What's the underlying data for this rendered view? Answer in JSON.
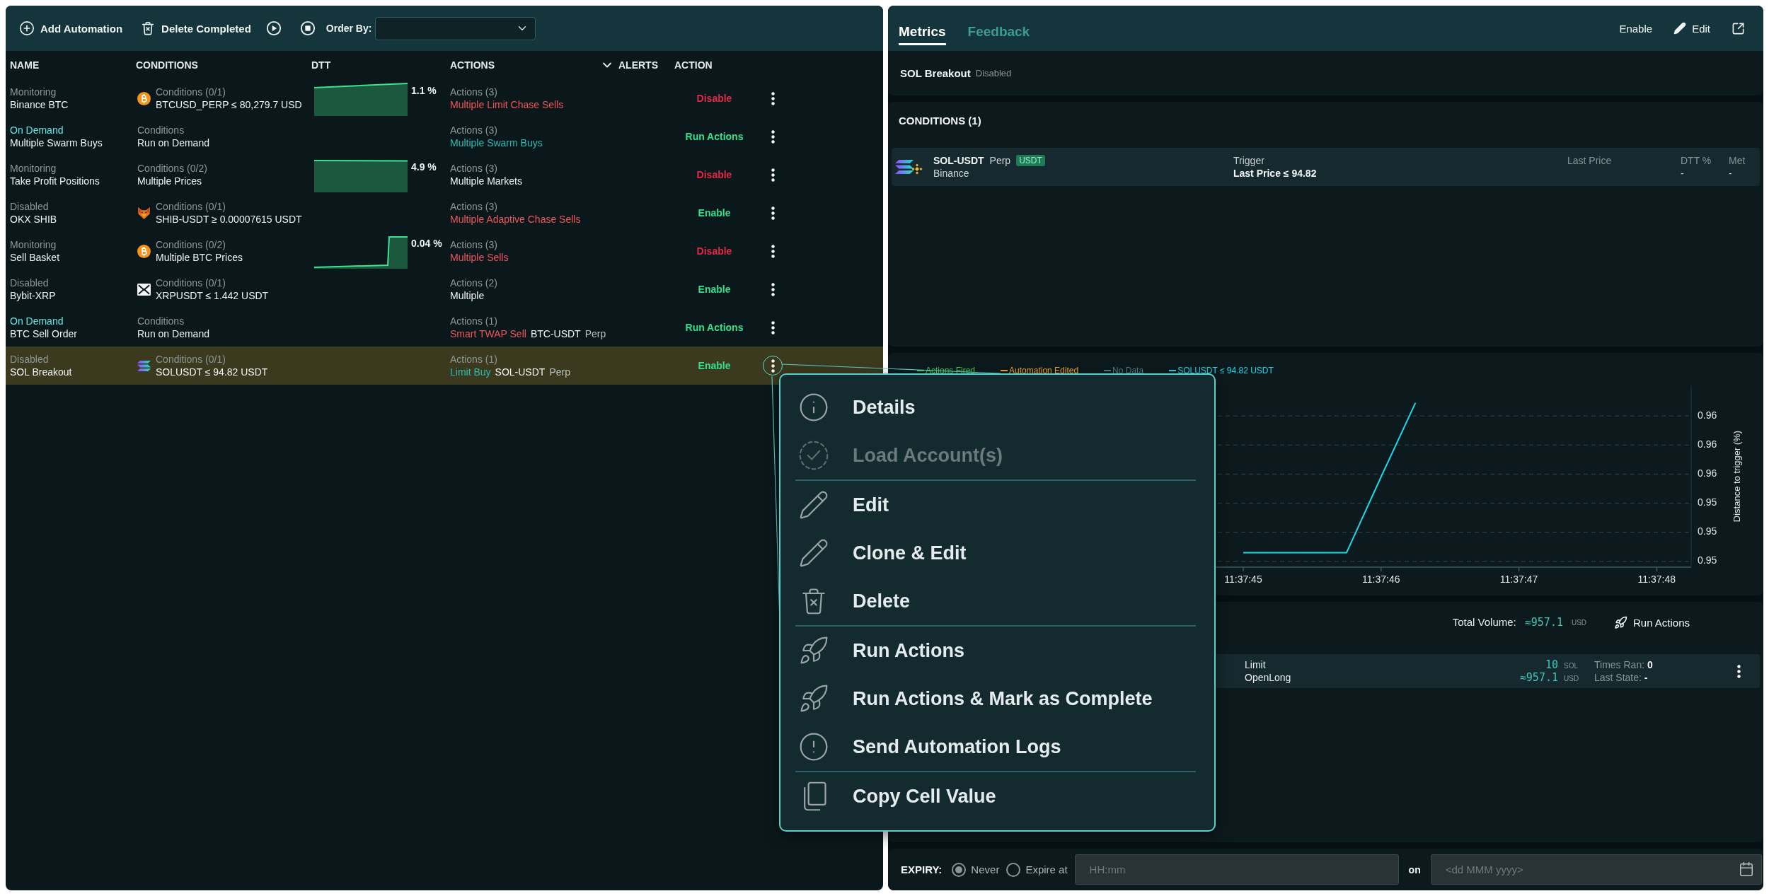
{
  "toolbar": {
    "buttons": [
      {
        "label": "Add Automation",
        "kind": "add"
      },
      {
        "label": "Delete Completed",
        "kind": "delete_completed"
      }
    ],
    "order_by": {
      "label": "Order By:"
    }
  },
  "table": {
    "columns": [
      {
        "label": "NAME",
        "caret": false
      },
      {
        "label": "CONDITIONS",
        "caret": false
      },
      {
        "label": "DTT",
        "caret": false
      },
      {
        "label": "ACTIONS",
        "caret": false
      },
      {
        "label": "ALERTS",
        "caret": true
      },
      {
        "label": "ACTION",
        "caret": false
      }
    ],
    "rows": [
      {
        "status": {
          "label": "Monitoring",
          "kind": "monitoring"
        },
        "name": "Binance BTC",
        "conditions": {
          "kind": "btc",
          "title": "Conditions (0/1)",
          "detail": "BTCUSD_PERP ≤ 80,279.7 USD"
        },
        "dtt": {
          "kind": "rising",
          "reading": "1.1 %"
        },
        "actions": {
          "title": "Actions (3)",
          "parts": [
            {
              "text": "Multiple Limit Chase Sells",
              "kind": "sell"
            }
          ]
        },
        "action": {
          "label": "Disable",
          "kind": "disable"
        },
        "selected": false,
        "menu_open": false
      },
      {
        "status": {
          "label": "On Demand",
          "kind": "on_demand"
        },
        "name": "Multiple Swarm Buys",
        "conditions": {
          "title": "Conditions",
          "detail": "Run on Demand"
        },
        "actions": {
          "title": "Actions (3)",
          "parts": [
            {
              "text": "Multiple Swarm Buys",
              "kind": "buy"
            }
          ]
        },
        "action": {
          "label": "Run Actions",
          "kind": "run"
        },
        "selected": false,
        "menu_open": false
      },
      {
        "status": {
          "label": "Monitoring",
          "kind": "monitoring"
        },
        "name": "Take Profit Positions",
        "conditions": {
          "title": "Conditions (0/2)",
          "detail": "Multiple Prices"
        },
        "dtt": {
          "kind": "flat",
          "reading": "4.9 %"
        },
        "actions": {
          "title": "Actions (3)",
          "parts": [
            {
              "text": "Multiple Markets",
              "kind": "plain"
            }
          ]
        },
        "action": {
          "label": "Disable",
          "kind": "disable"
        },
        "selected": false,
        "menu_open": false
      },
      {
        "status": {
          "label": "Disabled",
          "kind": "disabled"
        },
        "name": "OKX SHIB",
        "conditions": {
          "kind": "shib",
          "title": "Conditions (0/1)",
          "detail": "SHIB-USDT ≥ 0.00007615 USDT"
        },
        "actions": {
          "title": "Actions (3)",
          "parts": [
            {
              "text": "Multiple Adaptive Chase Sells",
              "kind": "sell"
            }
          ]
        },
        "action": {
          "label": "Enable",
          "kind": "enable"
        },
        "selected": false,
        "menu_open": false
      },
      {
        "status": {
          "label": "Monitoring",
          "kind": "monitoring"
        },
        "name": "Sell Basket",
        "conditions": {
          "kind": "btc",
          "title": "Conditions (0/2)",
          "detail": "Multiple BTC Prices"
        },
        "dtt": {
          "kind": "step",
          "reading": "0.04 %"
        },
        "actions": {
          "title": "Actions (3)",
          "parts": [
            {
              "text": "Multiple Sells",
              "kind": "sell"
            }
          ]
        },
        "action": {
          "label": "Disable",
          "kind": "disable"
        },
        "selected": false,
        "menu_open": false
      },
      {
        "status": {
          "label": "Disabled",
          "kind": "disabled"
        },
        "name": "Bybit-XRP",
        "conditions": {
          "kind": "xrp",
          "title": "Conditions (0/1)",
          "detail": "XRPUSDT ≤ 1.442 USDT"
        },
        "actions": {
          "title": "Actions (2)",
          "parts": [
            {
              "text": "Multiple",
              "kind": "plain"
            }
          ]
        },
        "action": {
          "label": "Enable",
          "kind": "enable"
        },
        "selected": false,
        "menu_open": false
      },
      {
        "status": {
          "label": "On Demand",
          "kind": "on_demand"
        },
        "name": "BTC Sell Order",
        "conditions": {
          "title": "Conditions",
          "detail": "Run on Demand"
        },
        "actions": {
          "title": "Actions (1)",
          "parts": [
            {
              "text": "Smart TWAP Sell",
              "kind": "sell"
            },
            {
              "text": "BTC-USDT",
              "kind": "plain"
            },
            {
              "text": "Perp",
              "kind": "muted"
            }
          ]
        },
        "action": {
          "label": "Run Actions",
          "kind": "run"
        },
        "selected": false,
        "menu_open": false
      },
      {
        "status": {
          "label": "Disabled",
          "kind": "disabled"
        },
        "name": "SOL Breakout",
        "conditions": {
          "kind": "sol",
          "title": "Conditions (0/1)",
          "detail": "SOLUSDT ≤ 94.82 USDT"
        },
        "actions": {
          "title": "Actions (1)",
          "parts": [
            {
              "text": "Limit Buy",
              "kind": "buy"
            },
            {
              "text": "SOL-USDT",
              "kind": "plain"
            },
            {
              "text": "Perp",
              "kind": "muted"
            }
          ]
        },
        "action": {
          "label": "Enable",
          "kind": "enable"
        },
        "selected": true,
        "menu_open": true
      }
    ]
  },
  "detail": {
    "tabs": [
      {
        "label": "Metrics",
        "selected": true
      },
      {
        "label": "Feedback",
        "selected": false
      }
    ],
    "header_actions": {
      "enable": "Enable",
      "edit": "Edit"
    },
    "title": "SOL Breakout",
    "status": "Disabled",
    "conditions": {
      "title": "CONDITIONS (1)",
      "items": [
        {
          "symbol": "SOL-USDT",
          "contract": "Perp",
          "quote_badge": "USDT",
          "exchange": "Binance",
          "trigger_label": "Trigger",
          "trigger": "Last Price ≤ 94.82",
          "last_price_label": "Last Price",
          "dtt_label": "DTT %",
          "dtt": "-",
          "met_label": "Met",
          "met": "-"
        }
      ]
    },
    "chart": {
      "chart_data": {
        "type": "line",
        "ylabel": "Distance to trigger (%)",
        "grid": true,
        "categories": [
          null,
          null,
          null,
          null,
          null,
          null,
          null,
          null,
          null,
          null,
          "11:37:45",
          null,
          null,
          null,
          "11:37:46",
          null,
          null,
          null,
          "11:37:47",
          null,
          null,
          null,
          "11:37:48",
          null
        ],
        "series": [
          {
            "name": "Actions Fired",
            "color": "#39d353",
            "values": [
              null,
              null,
              null,
              null,
              null,
              null,
              null,
              null,
              null,
              null,
              null,
              null,
              null,
              null,
              null,
              null,
              null,
              null,
              null,
              null,
              null,
              null,
              null,
              null
            ]
          },
          {
            "name": "Automation Edited",
            "color": "#f5a623",
            "values": [
              null,
              null,
              null,
              null,
              null,
              null,
              null,
              null,
              null,
              null,
              null,
              null,
              null,
              null,
              null,
              null,
              null,
              null,
              null,
              null,
              null,
              null,
              null,
              null
            ]
          },
          {
            "name": "No Data",
            "color": "#4f7f86",
            "values": [
              null,
              null,
              null,
              null,
              null,
              null,
              null,
              null,
              null,
              null,
              null,
              null,
              null,
              null,
              null,
              null,
              null,
              null,
              null,
              null,
              null,
              null,
              null,
              null
            ]
          },
          {
            "name": "SOLUSDT ≤ 94.82 USDT",
            "color": "#1ed8ea",
            "values": [
              null,
              null,
              null,
              null,
              null,
              null,
              null,
              null,
              null,
              null,
              0.9506,
              0.9506,
              0.9506,
              0.9506,
              0.9558,
              0.9609,
              null,
              null,
              null,
              null,
              null,
              null,
              null,
              null
            ]
          }
        ],
        "ylim": [
          0.9496,
          0.9621
        ],
        "yticks": [
          {
            "value": 0.96,
            "label": "0.96"
          },
          {
            "value": 0.958,
            "label": "0.96"
          },
          {
            "value": 0.956,
            "label": "0.96"
          },
          {
            "value": 0.954,
            "label": "0.95"
          },
          {
            "value": 0.952,
            "label": "0.95"
          },
          {
            "value": 0.95,
            "label": "0.95"
          }
        ]
      }
    },
    "actions": {
      "total_label": "Total Volume:",
      "total": "≈957.1",
      "total_unit": "USD",
      "run": "Run Actions",
      "items": [
        {
          "order_type": "Limit",
          "side": "OpenLong",
          "quantity": "10",
          "quantity_unit": "SOL",
          "value": "≈957.1",
          "value_unit": "USD",
          "times_ran": "Times Ran: **0**",
          "last_state": "Last State: **-**"
        }
      ]
    },
    "expiry": {
      "label": "EXPIRY:",
      "options": [
        {
          "label": "Never",
          "selected": true
        },
        {
          "label": "Expire at",
          "selected": false
        }
      ],
      "time_field": {
        "placeholder": "HH:mm"
      },
      "on_label": "on",
      "date_field": {
        "placeholder": "<dd MMM yyyy>"
      }
    }
  },
  "context_menu": {
    "groups": [
      {
        "items": [
          {
            "label": "Details",
            "kind": "details",
            "disabled": false
          },
          {
            "label": "Load Account(s)",
            "kind": "load_accounts",
            "disabled": true
          }
        ]
      },
      {
        "items": [
          {
            "label": "Edit",
            "kind": "edit",
            "disabled": false
          },
          {
            "label": "Clone & Edit",
            "kind": "clone",
            "disabled": false
          },
          {
            "label": "Delete",
            "kind": "delete",
            "disabled": false
          }
        ]
      },
      {
        "items": [
          {
            "label": "Run Actions",
            "kind": "run",
            "disabled": false
          },
          {
            "label": "Run Actions & Mark as Complete",
            "kind": "run_complete",
            "disabled": false
          },
          {
            "label": "Send Automation Logs",
            "kind": "logs",
            "disabled": false
          }
        ]
      },
      {
        "items": [
          {
            "label": "Copy Cell Value",
            "kind": "copy",
            "disabled": false
          }
        ]
      }
    ]
  }
}
